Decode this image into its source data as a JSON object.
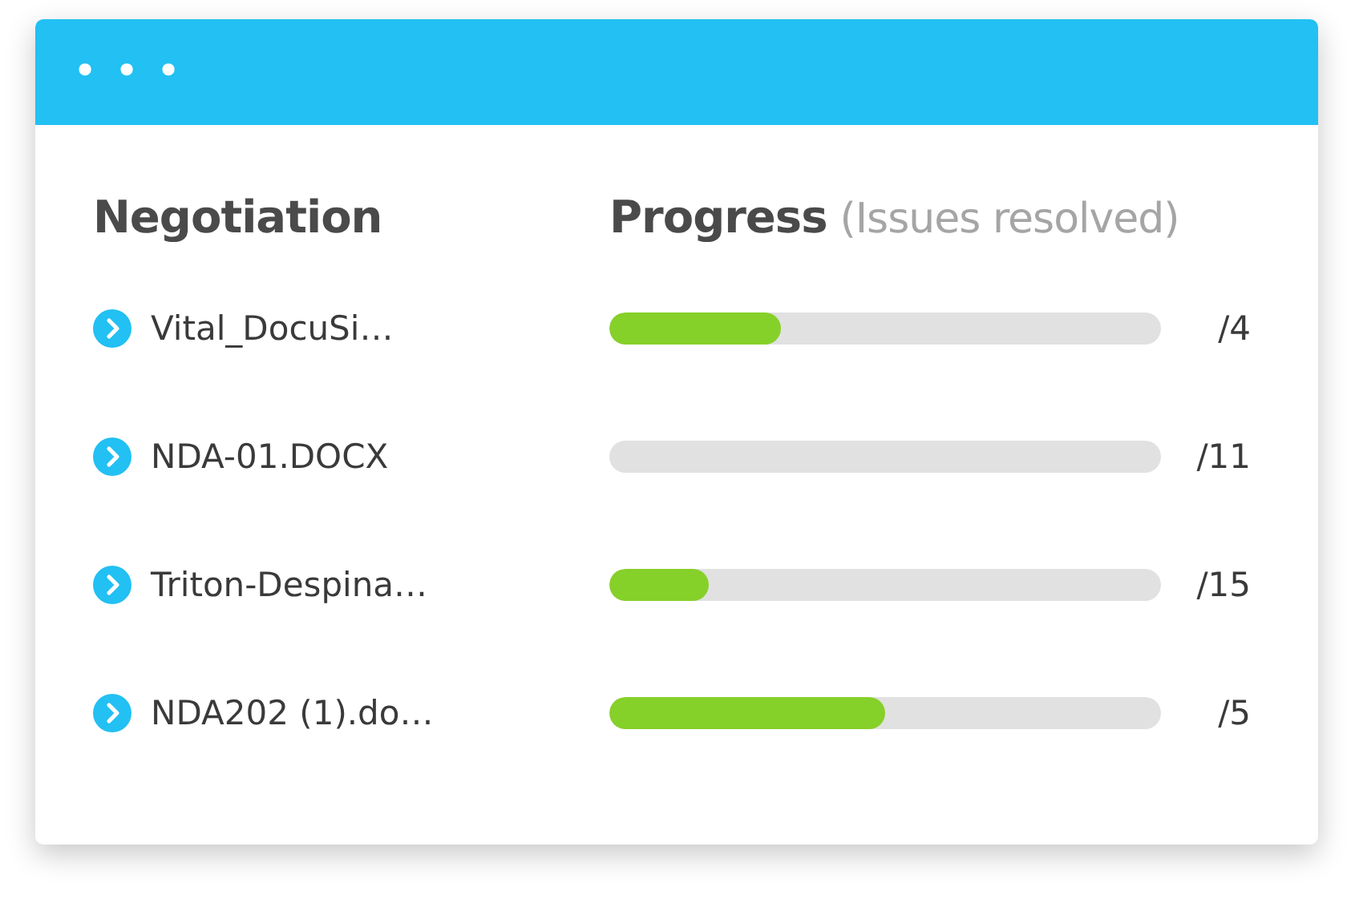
{
  "window": {
    "controls": [
      "•",
      "•",
      "•"
    ]
  },
  "columns": {
    "negotiation": "Negotiation",
    "progress": "Progress",
    "progress_note": "(Issues resolved)"
  },
  "rows": [
    {
      "name": "Vital_DocuSi…",
      "level": 0.31,
      "count": "/4"
    },
    {
      "name": "NDA-01.DOCX",
      "count": "/11"
    },
    {
      "name": "Triton-Despina…",
      "level": 0.18,
      "count": "/15"
    },
    {
      "name": "NDA202 (1).do…",
      "level": 0.5,
      "count": "/5"
    }
  ]
}
